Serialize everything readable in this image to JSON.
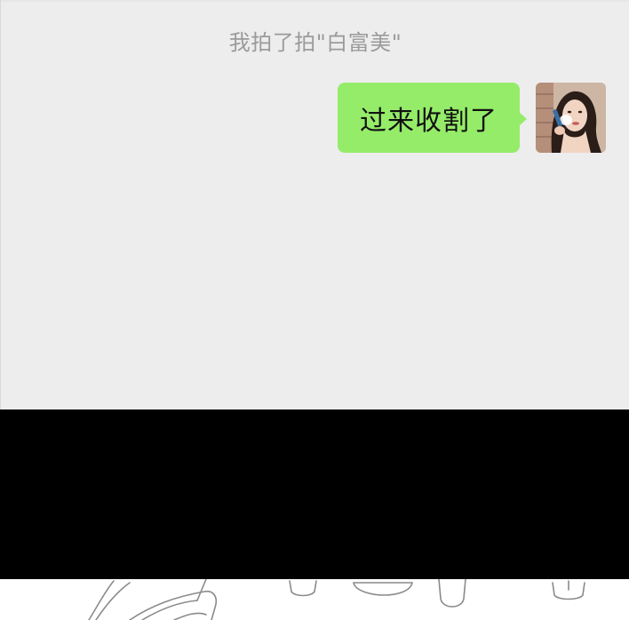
{
  "chat": {
    "system_message": "我拍了拍\"白富美\"",
    "messages": [
      {
        "text": "过来收割了",
        "bubble_color": "#95ec69"
      }
    ],
    "avatar_icon": "woman-portrait-avatar"
  },
  "colors": {
    "chat_background": "#ededed",
    "system_text": "#9b9b9b",
    "band": "#000000",
    "sketch_lines": "#8a8a8a"
  },
  "icons": {
    "sketch": "pencil-sketch-illustration"
  }
}
